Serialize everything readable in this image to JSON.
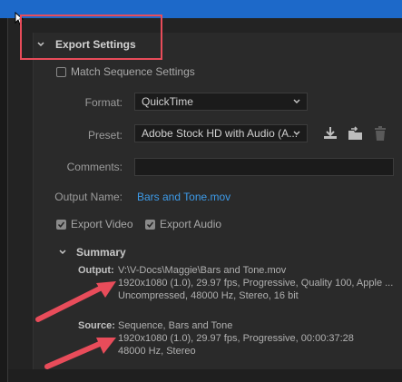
{
  "export_settings": {
    "title": "Export Settings",
    "match_sequence_label": "Match Sequence Settings",
    "match_sequence_checked": false,
    "format_label": "Format:",
    "format_value": "QuickTime",
    "preset_label": "Preset:",
    "preset_value": "Adobe Stock HD with Audio (A...",
    "comments_label": "Comments:",
    "comments_value": "",
    "output_name_label": "Output Name:",
    "output_name_value": "Bars and Tone.mov",
    "export_video_label": "Export Video",
    "export_video_checked": true,
    "export_audio_label": "Export Audio",
    "export_audio_checked": true
  },
  "summary": {
    "title": "Summary",
    "output_label": "Output:",
    "output_line1": "V:\\V-Docs\\Maggie\\Bars and Tone.mov",
    "output_line2": "1920x1080 (1.0), 29.97 fps, Progressive, Quality 100, Apple ...",
    "output_line3": "Uncompressed, 48000 Hz, Stereo, 16 bit",
    "source_label": "Source:",
    "source_line1": "Sequence, Bars and Tone",
    "source_line2": "1920x1080 (1.0), 29.97 fps, Progressive, 00:00:37:28",
    "source_line3": "48000 Hz, Stereo"
  },
  "icons": {
    "save_preset": "download-icon",
    "import_preset": "import-preset-icon",
    "delete_preset": "trash-icon"
  },
  "colors": {
    "annotation_red": "#e84c5a",
    "link_blue": "#3d9be9",
    "top_bar_blue": "#1d69c9"
  }
}
